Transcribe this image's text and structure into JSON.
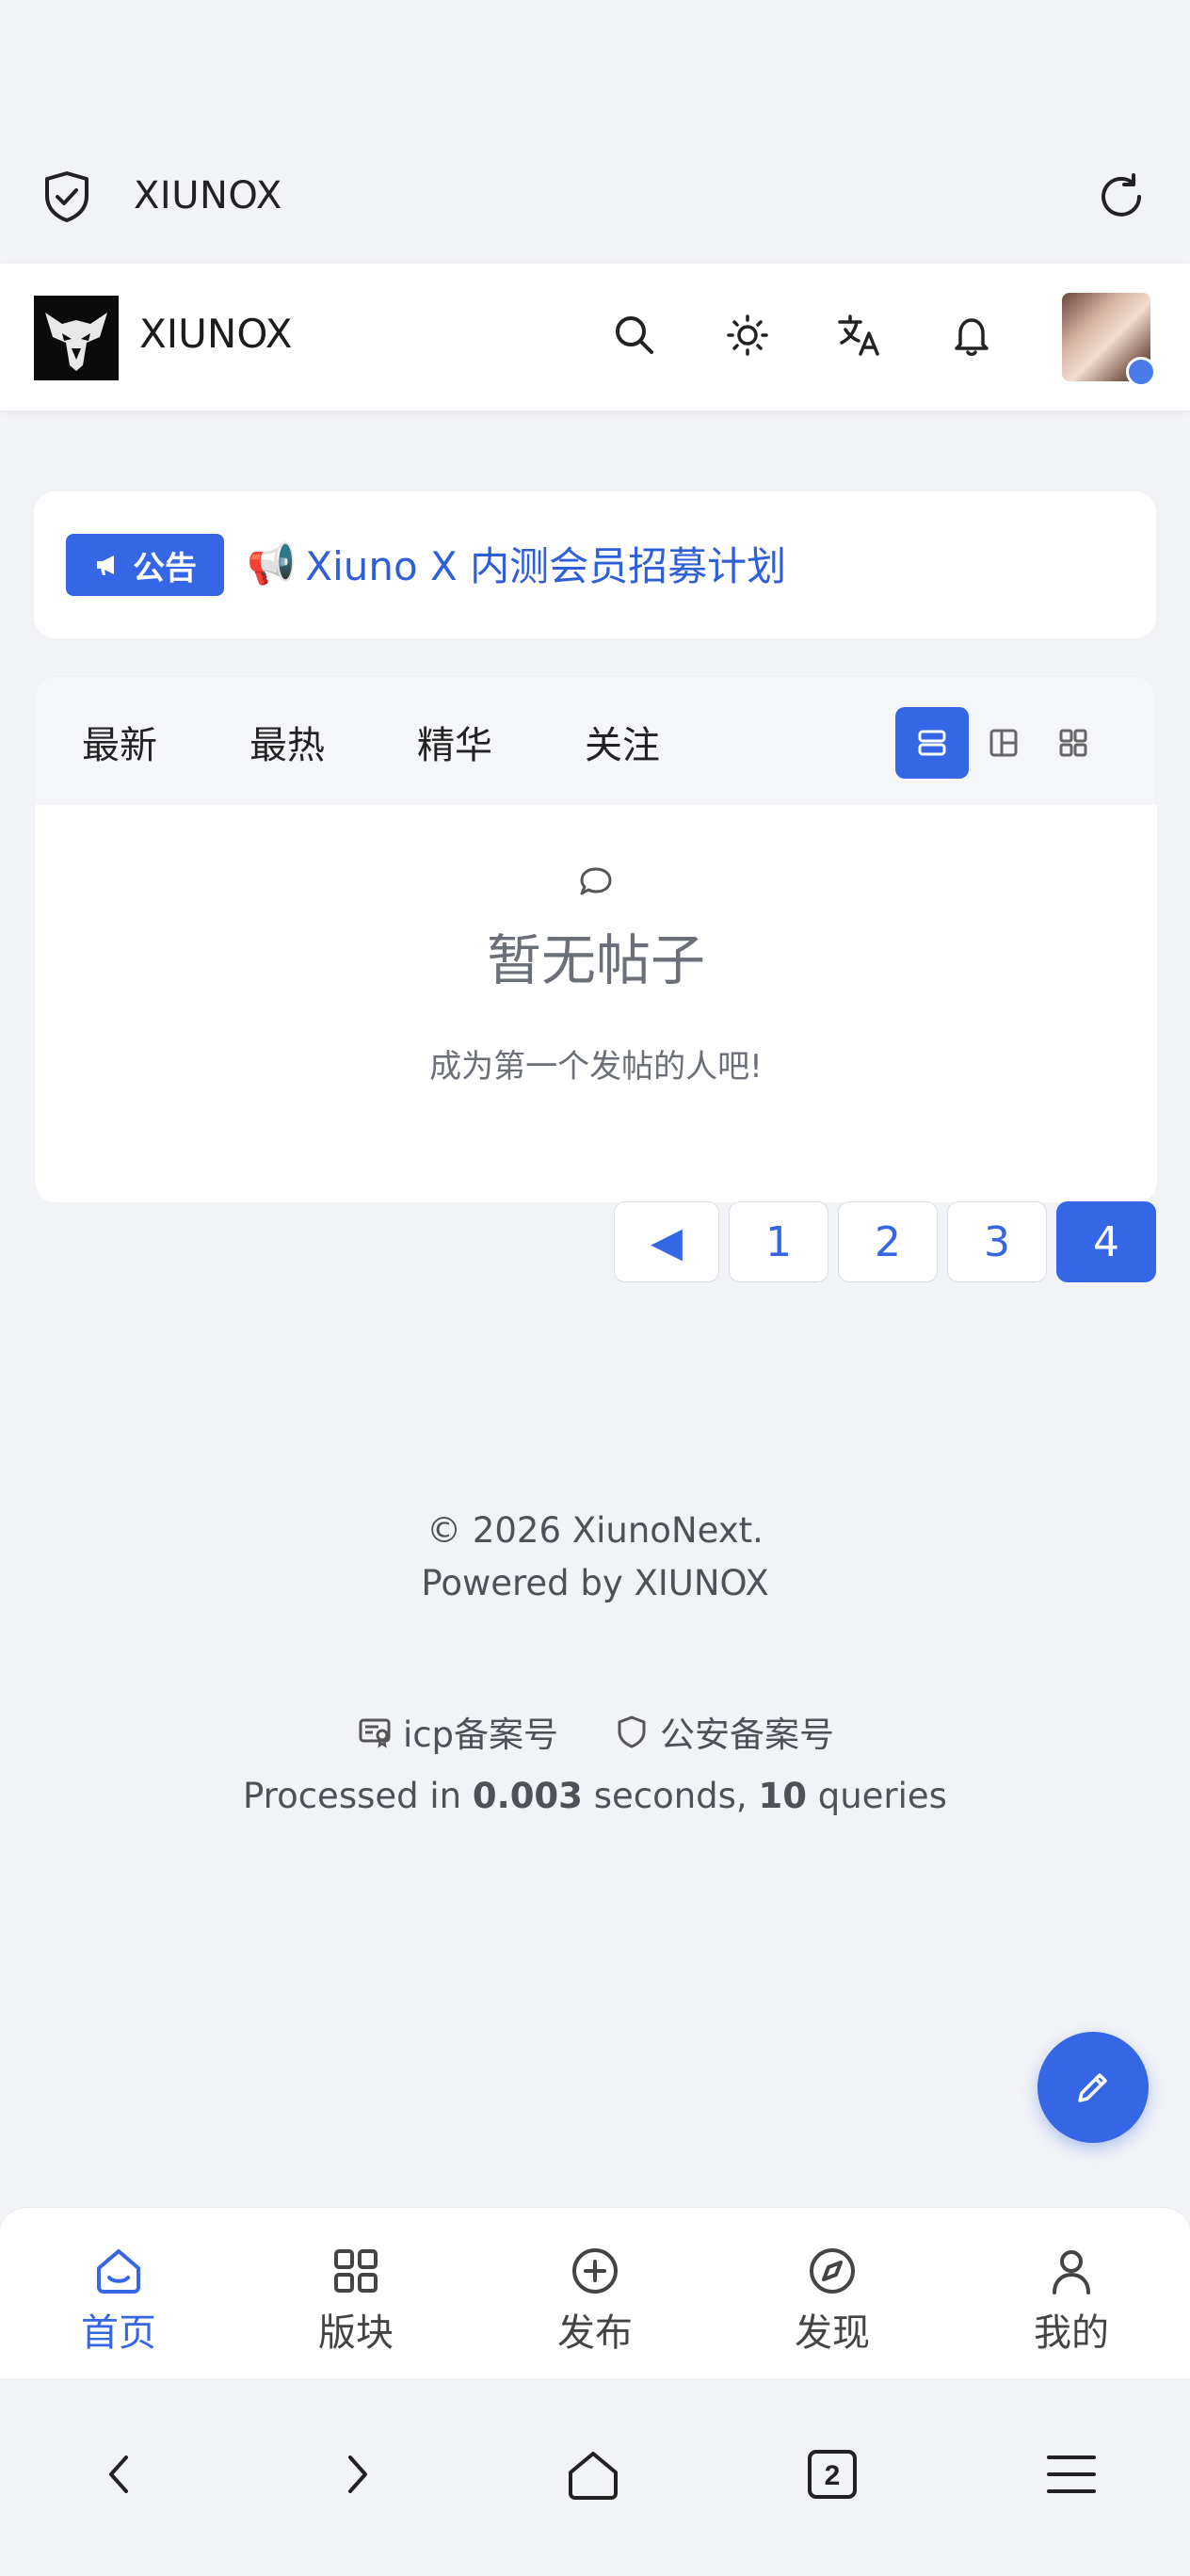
{
  "browser": {
    "url": "XIUNOX",
    "shield_icon": "shield-check-icon",
    "reload_icon": "reload-icon"
  },
  "header": {
    "site_name": "XIUNOX",
    "icons": [
      "search-icon",
      "sun-icon",
      "translate-icon",
      "bell-icon"
    ]
  },
  "announcement": {
    "tag": "公告",
    "emoji": "📢",
    "text": "Xiuno X 内测会员招募计划"
  },
  "tabs": [
    "最新",
    "最热",
    "精华",
    "关注"
  ],
  "view_modes": {
    "active": "list",
    "modes": [
      "list",
      "card",
      "grid"
    ]
  },
  "empty": {
    "title": "暂无帖子",
    "subtitle": "成为第一个发帖的人吧!"
  },
  "pagination": {
    "prev": "◀",
    "pages": [
      "1",
      "2",
      "3",
      "4"
    ],
    "current": "4"
  },
  "footer": {
    "copyright": "© 2026 XiunoNext.",
    "powered": "Powered by XIUNOX",
    "icp": "icp备案号",
    "police": "公安备案号",
    "processed_prefix": "Processed in ",
    "seconds": "0.003",
    "seconds_suffix": " seconds, ",
    "queries": "10",
    "queries_suffix": " queries"
  },
  "bottom_nav": [
    {
      "label": "首页",
      "icon": "home-icon",
      "active": true
    },
    {
      "label": "版块",
      "icon": "grid-icon",
      "active": false
    },
    {
      "label": "发布",
      "icon": "plus-circle-icon",
      "active": false
    },
    {
      "label": "发现",
      "icon": "compass-icon",
      "active": false
    },
    {
      "label": "我的",
      "icon": "user-icon",
      "active": false
    }
  ],
  "system_bar": {
    "tab_count": "2"
  },
  "colors": {
    "accent": "#3566e6",
    "background": "#f2f3f7"
  }
}
